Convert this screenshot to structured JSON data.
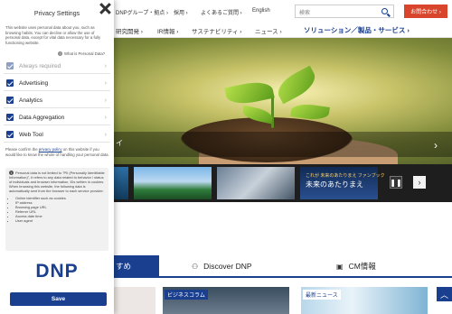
{
  "site": {
    "topbar": {
      "group_link": "DNPグループ・拠点 ›",
      "careers_link": "採用 ›",
      "faq_link": "よくあるご質問 ›",
      "language": "English",
      "search_placeholder": "検索",
      "contact_button": "お問合わせ ›"
    },
    "nav": {
      "items": [
        "研究開発 ›",
        "IR情報 ›",
        "サステナビリティ ›",
        "ニュース ›"
      ],
      "solution_link": "ソリューション／製品・サービス ›"
    },
    "hero": {
      "band_text": "イ",
      "next_arrow": "›"
    },
    "carousel": {
      "thumb_caption": "未来のあたりまえ",
      "thumb_caption_small": "これが 未来のあたりまえ ファンブック",
      "pause": "❚❚",
      "next": "›"
    },
    "tabs": {
      "active": "すめ",
      "discover": "Discover DNP",
      "discover_icon": "binoculars-icon",
      "cm": "CM情報",
      "cm_icon": "film-icon"
    },
    "cards": {
      "business_column": "ビジネスコラム",
      "latest_news": "最新ニュース"
    },
    "scroll_top": "︿"
  },
  "privacy": {
    "title": "Privacy Settings",
    "intro": "This website uses personal data about you, such as browsing habits. You can decline or allow the use of personal data, except for vital data necessary for a fully functioning website.",
    "what_link": "What is Personal Data?",
    "categories": [
      {
        "label": "Always required",
        "disabled": true
      },
      {
        "label": "Advertising",
        "disabled": false
      },
      {
        "label": "Analytics",
        "disabled": false
      },
      {
        "label": "Data Aggregation",
        "disabled": false
      },
      {
        "label": "Web Tool",
        "disabled": false
      }
    ],
    "confirm_pre": "Please confirm the ",
    "confirm_link": "privacy policy",
    "confirm_post": " on this website if you would like to know the whole of handling your personal data.",
    "info_text": "Personal data is not limited to \"PII (Personally Identifiable Information)\", it refers to any data related to behavior / status of individuals and browser information, IDs written in cookies. When browsing this website, the following data is automatically sent from the browser to each service provider.",
    "info_list": [
      "Online identifier such as cookies",
      "IP address",
      "Browsing page URL",
      "Referrer URL",
      "Access date time",
      "User agent"
    ],
    "logo": "DNP",
    "save_label": "Save"
  },
  "colors": {
    "brand_blue": "#1a3f8f",
    "contact_red": "#d9452a"
  }
}
